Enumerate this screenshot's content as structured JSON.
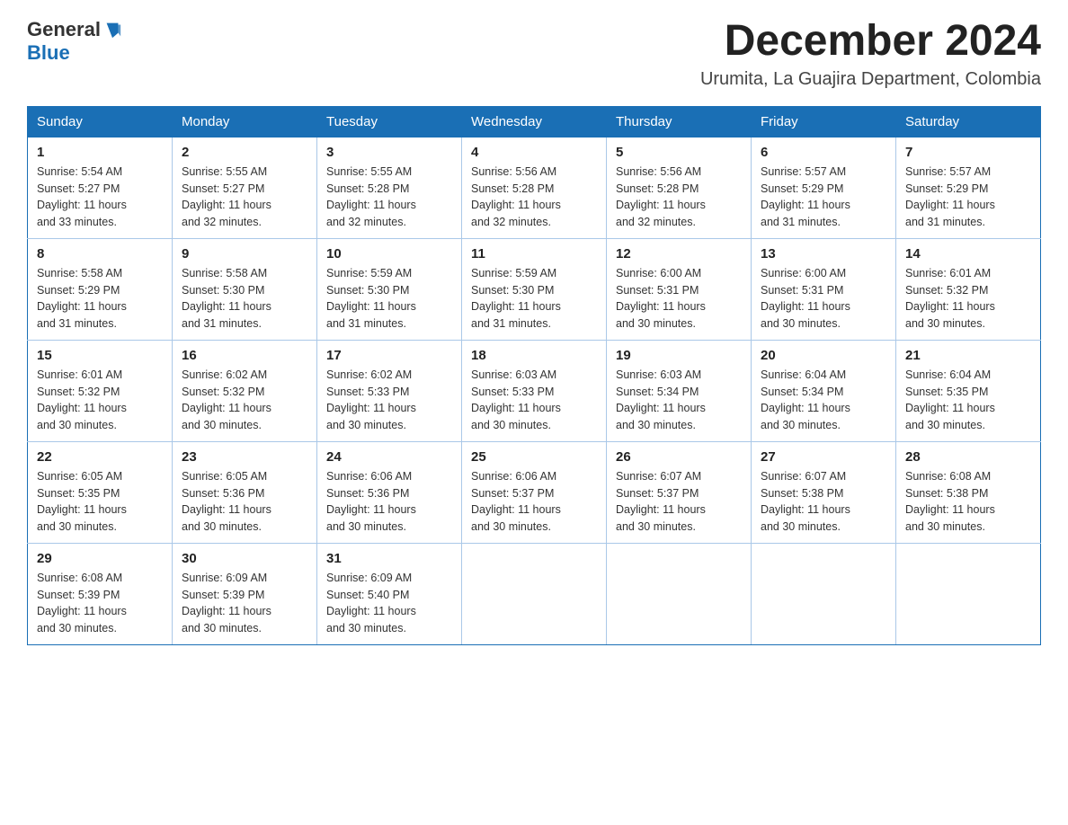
{
  "logo": {
    "general": "General",
    "blue": "Blue"
  },
  "header": {
    "month": "December 2024",
    "location": "Urumita, La Guajira Department, Colombia"
  },
  "weekdays": [
    "Sunday",
    "Monday",
    "Tuesday",
    "Wednesday",
    "Thursday",
    "Friday",
    "Saturday"
  ],
  "weeks": [
    [
      {
        "day": "1",
        "sunrise": "5:54 AM",
        "sunset": "5:27 PM",
        "daylight": "11 hours and 33 minutes."
      },
      {
        "day": "2",
        "sunrise": "5:55 AM",
        "sunset": "5:27 PM",
        "daylight": "11 hours and 32 minutes."
      },
      {
        "day": "3",
        "sunrise": "5:55 AM",
        "sunset": "5:28 PM",
        "daylight": "11 hours and 32 minutes."
      },
      {
        "day": "4",
        "sunrise": "5:56 AM",
        "sunset": "5:28 PM",
        "daylight": "11 hours and 32 minutes."
      },
      {
        "day": "5",
        "sunrise": "5:56 AM",
        "sunset": "5:28 PM",
        "daylight": "11 hours and 32 minutes."
      },
      {
        "day": "6",
        "sunrise": "5:57 AM",
        "sunset": "5:29 PM",
        "daylight": "11 hours and 31 minutes."
      },
      {
        "day": "7",
        "sunrise": "5:57 AM",
        "sunset": "5:29 PM",
        "daylight": "11 hours and 31 minutes."
      }
    ],
    [
      {
        "day": "8",
        "sunrise": "5:58 AM",
        "sunset": "5:29 PM",
        "daylight": "11 hours and 31 minutes."
      },
      {
        "day": "9",
        "sunrise": "5:58 AM",
        "sunset": "5:30 PM",
        "daylight": "11 hours and 31 minutes."
      },
      {
        "day": "10",
        "sunrise": "5:59 AM",
        "sunset": "5:30 PM",
        "daylight": "11 hours and 31 minutes."
      },
      {
        "day": "11",
        "sunrise": "5:59 AM",
        "sunset": "5:30 PM",
        "daylight": "11 hours and 31 minutes."
      },
      {
        "day": "12",
        "sunrise": "6:00 AM",
        "sunset": "5:31 PM",
        "daylight": "11 hours and 30 minutes."
      },
      {
        "day": "13",
        "sunrise": "6:00 AM",
        "sunset": "5:31 PM",
        "daylight": "11 hours and 30 minutes."
      },
      {
        "day": "14",
        "sunrise": "6:01 AM",
        "sunset": "5:32 PM",
        "daylight": "11 hours and 30 minutes."
      }
    ],
    [
      {
        "day": "15",
        "sunrise": "6:01 AM",
        "sunset": "5:32 PM",
        "daylight": "11 hours and 30 minutes."
      },
      {
        "day": "16",
        "sunrise": "6:02 AM",
        "sunset": "5:32 PM",
        "daylight": "11 hours and 30 minutes."
      },
      {
        "day": "17",
        "sunrise": "6:02 AM",
        "sunset": "5:33 PM",
        "daylight": "11 hours and 30 minutes."
      },
      {
        "day": "18",
        "sunrise": "6:03 AM",
        "sunset": "5:33 PM",
        "daylight": "11 hours and 30 minutes."
      },
      {
        "day": "19",
        "sunrise": "6:03 AM",
        "sunset": "5:34 PM",
        "daylight": "11 hours and 30 minutes."
      },
      {
        "day": "20",
        "sunrise": "6:04 AM",
        "sunset": "5:34 PM",
        "daylight": "11 hours and 30 minutes."
      },
      {
        "day": "21",
        "sunrise": "6:04 AM",
        "sunset": "5:35 PM",
        "daylight": "11 hours and 30 minutes."
      }
    ],
    [
      {
        "day": "22",
        "sunrise": "6:05 AM",
        "sunset": "5:35 PM",
        "daylight": "11 hours and 30 minutes."
      },
      {
        "day": "23",
        "sunrise": "6:05 AM",
        "sunset": "5:36 PM",
        "daylight": "11 hours and 30 minutes."
      },
      {
        "day": "24",
        "sunrise": "6:06 AM",
        "sunset": "5:36 PM",
        "daylight": "11 hours and 30 minutes."
      },
      {
        "day": "25",
        "sunrise": "6:06 AM",
        "sunset": "5:37 PM",
        "daylight": "11 hours and 30 minutes."
      },
      {
        "day": "26",
        "sunrise": "6:07 AM",
        "sunset": "5:37 PM",
        "daylight": "11 hours and 30 minutes."
      },
      {
        "day": "27",
        "sunrise": "6:07 AM",
        "sunset": "5:38 PM",
        "daylight": "11 hours and 30 minutes."
      },
      {
        "day": "28",
        "sunrise": "6:08 AM",
        "sunset": "5:38 PM",
        "daylight": "11 hours and 30 minutes."
      }
    ],
    [
      {
        "day": "29",
        "sunrise": "6:08 AM",
        "sunset": "5:39 PM",
        "daylight": "11 hours and 30 minutes."
      },
      {
        "day": "30",
        "sunrise": "6:09 AM",
        "sunset": "5:39 PM",
        "daylight": "11 hours and 30 minutes."
      },
      {
        "day": "31",
        "sunrise": "6:09 AM",
        "sunset": "5:40 PM",
        "daylight": "11 hours and 30 minutes."
      },
      null,
      null,
      null,
      null
    ]
  ],
  "labels": {
    "sunrise": "Sunrise: ",
    "sunset": "Sunset: ",
    "daylight": "Daylight: "
  }
}
